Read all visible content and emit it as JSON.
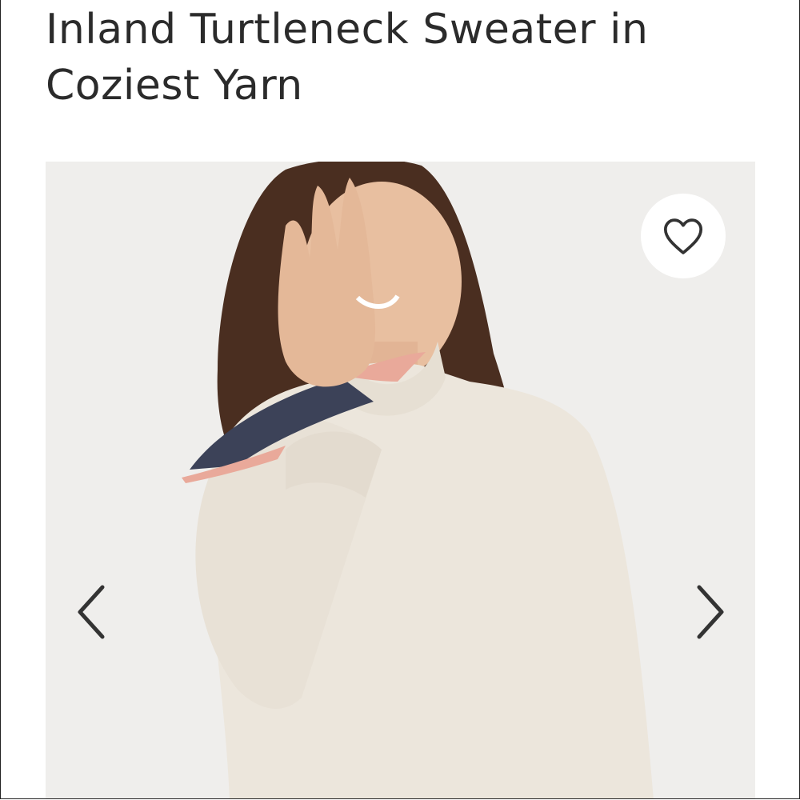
{
  "product": {
    "title": "Inland Turtleneck Sweater in Coziest Yarn"
  },
  "gallery": {
    "favorite_icon": "heart-outline-icon",
    "prev_icon": "chevron-left-icon",
    "next_icon": "chevron-right-icon"
  },
  "colors": {
    "gallery_background": "#efeeec",
    "sweater": "#ece6dc",
    "hair": "#4a2e20",
    "skin": "#e8bfa0",
    "scarf_dark": "#3c4258",
    "scarf_pink": "#e9a99a",
    "icon_stroke": "#333333"
  }
}
